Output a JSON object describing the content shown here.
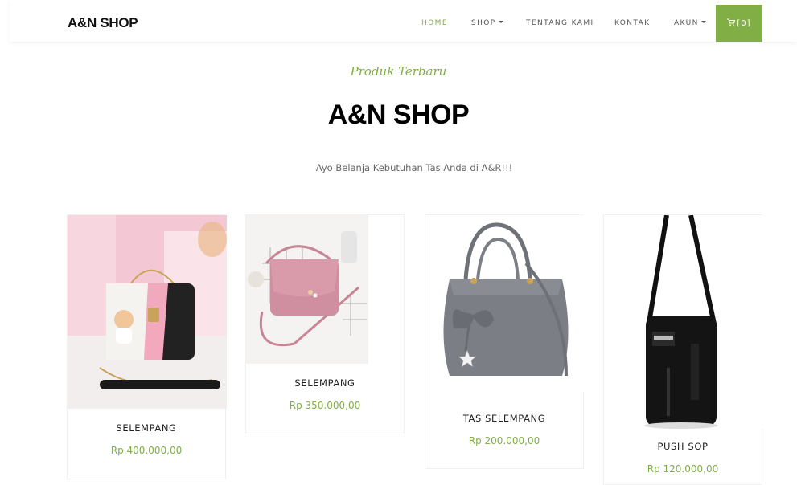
{
  "nav": {
    "brand": "A&N SHOP",
    "items": [
      {
        "label": "HOME",
        "active": true
      },
      {
        "label": "SHOP",
        "dropdown": true
      },
      {
        "label": "TENTANG KAMI"
      },
      {
        "label": "KONTAK"
      },
      {
        "label": "AKUN",
        "dropdown": true
      }
    ],
    "cart": {
      "icon": "cart-icon",
      "label": "[0]"
    }
  },
  "hero": {
    "subheading": "Produk Terbaru",
    "heading": "A&N SHOP",
    "tagline": "Ayo Belanja Kebutuhan Tas Anda di A&R!!!"
  },
  "products": [
    {
      "name": "SELEMPANG",
      "price": "Rp 400.000,00",
      "image": "black-white-pink-crossbody-bag-with-bear-keychain"
    },
    {
      "name": "SELEMPANG",
      "price": "Rp 350.000,00",
      "image": "pink-crossbody-bag"
    },
    {
      "name": "TAS SELEMPANG",
      "price": "Rp 200.000,00",
      "image": "grey-handbag-with-bow"
    },
    {
      "name": "PUSH SOP",
      "price": "Rp 120.000,00",
      "image": "black-pushop-sling-bag"
    }
  ],
  "colors": {
    "accent": "#82ae46",
    "text": "#222222",
    "muted": "#666666"
  }
}
